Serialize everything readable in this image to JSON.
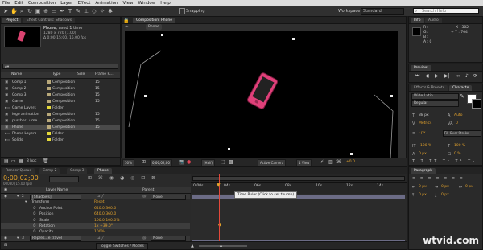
{
  "menu": [
    "File",
    "Edit",
    "Composition",
    "Layer",
    "Effect",
    "Animation",
    "View",
    "Window",
    "Help"
  ],
  "toolbar": {
    "snapping": "Snapping",
    "workspace_label": "Workspace",
    "workspace_value": "Standard",
    "search_placeholder": "Search Help"
  },
  "project": {
    "tab_project": "Project",
    "tab_effect_controls": "Effect Controls: Shadows",
    "selected_name": "Phone",
    "selected_used": ", used 1 time",
    "selected_size": "1280 x 720 (1.00)",
    "selected_duration": "Δ 0;00;15;00, 15.00 fps",
    "search_value": "ρ▾",
    "columns": {
      "name": "Name",
      "type": "Type",
      "size": "Size",
      "frame_rate": "Frame R..."
    },
    "items": [
      {
        "name": "Comp 1",
        "type": "Composition",
        "rate": "15",
        "color": "#b8a87a",
        "icon": "composition-icon"
      },
      {
        "name": "Comp 2",
        "type": "Composition",
        "rate": "15",
        "color": "#b8a87a",
        "icon": "composition-icon"
      },
      {
        "name": "Comp 3",
        "type": "Composition",
        "rate": "15",
        "color": "#b8a87a",
        "icon": "composition-icon"
      },
      {
        "name": "Game",
        "type": "Composition",
        "rate": "15",
        "color": "#b8a87a",
        "icon": "composition-icon"
      },
      {
        "name": "Game Layers",
        "type": "Folder",
        "rate": "",
        "color": "#e5d93a",
        "icon": "folder-icon"
      },
      {
        "name": "logo animation",
        "type": "Composition",
        "rate": "15",
        "color": "#b8a87a",
        "icon": "composition-icon"
      },
      {
        "name": "pursbor...ume",
        "type": "Composition",
        "rate": "15",
        "color": "#b8a87a",
        "icon": "composition-icon"
      },
      {
        "name": "Phone",
        "type": "Composition",
        "rate": "15",
        "color": "#b8a87a",
        "icon": "composition-icon",
        "selected": true
      },
      {
        "name": "Phone Layers",
        "type": "Folder",
        "rate": "",
        "color": "#e5d93a",
        "icon": "folder-icon"
      },
      {
        "name": "Solids",
        "type": "Folder",
        "rate": "",
        "color": "#e5d93a",
        "icon": "folder-icon"
      }
    ],
    "bpc": "8 bpc"
  },
  "composition": {
    "tab": "Composition: Phone",
    "sub_tab": "Phone",
    "footer": {
      "zoom": "50%",
      "timecode": "0;00;02;00",
      "quality": "(Half)",
      "camera": "Active Camera",
      "views": "1 View",
      "exposure": "+0.0"
    }
  },
  "info": {
    "tab_info": "Info",
    "tab_audio": "Audio",
    "r": "R :",
    "g": "G :",
    "b": "B :",
    "a": "A : 0",
    "x": "X : 302",
    "y": "+ Y : 704"
  },
  "preview": {
    "tab": "Preview"
  },
  "character": {
    "tab_effects": "Effects & Presets",
    "tab_character": "Characte",
    "font": "Wide Latin",
    "style": "Regular",
    "size": "38 px",
    "leading": "Auto",
    "kerning": "Metrics",
    "tracking": "0",
    "stroke": "- px",
    "stroke_mode": "Fill Over Stroke",
    "vscale": "100 %",
    "hscale": "100 %",
    "baseline": "0 px",
    "tsume": "0 %"
  },
  "paragraph": {
    "tab": "Paragraph",
    "f1": "0 px",
    "f2": "0 px",
    "f3": "0 px",
    "f4": "0 px",
    "f5": "0 px"
  },
  "timeline": {
    "tabs": [
      "Render Queue",
      "Comp 2",
      "Comp 3",
      "Phone"
    ],
    "timecode": "0;00;02;00",
    "frame_info": "00030 (15.00 fps)",
    "columns": {
      "layer_name": "Layer Name",
      "parent": "Parent"
    },
    "ruler": [
      "0:00s",
      "04s",
      "06s",
      "08s",
      "10s",
      "12s",
      "14s"
    ],
    "tooltip": "Time Ruler (Click to set thumb)",
    "layers": [
      {
        "num": "2",
        "name": "[Shadows]",
        "parent": "None",
        "kind": "layer"
      },
      {
        "name": "Transform",
        "value": "Reset",
        "kind": "group"
      },
      {
        "name": "Anchor Point",
        "value": "640.0,360.0",
        "kind": "prop"
      },
      {
        "name": "Position",
        "value": "640.0,360.0",
        "kind": "prop"
      },
      {
        "name": "Scale",
        "value": "100.0,100.0%",
        "kind": "prop"
      },
      {
        "name": "Rotation",
        "value": "1x +39.0°",
        "kind": "prop",
        "selected": true
      },
      {
        "name": "Opacity",
        "value": "100%",
        "kind": "prop"
      },
      {
        "num": "3",
        "name": "Repres...e travel",
        "parent": "None",
        "kind": "layer"
      }
    ],
    "footer": "Toggle Switches / Modes"
  },
  "watermark": "wtvid.com"
}
